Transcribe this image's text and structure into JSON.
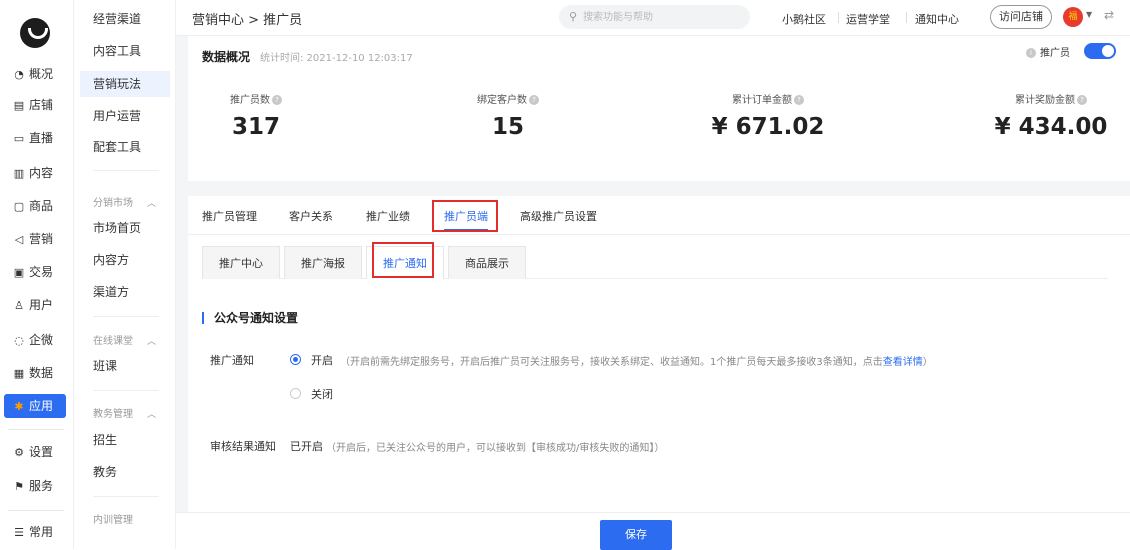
{
  "rail": {
    "items": [
      {
        "icon": "◔",
        "label": "概况"
      },
      {
        "icon": "▤",
        "label": "店铺"
      },
      {
        "icon": "▭",
        "label": "直播"
      },
      {
        "icon": "▥",
        "label": "内容"
      },
      {
        "icon": "▢",
        "label": "商品"
      },
      {
        "icon": "◁",
        "label": "营销"
      },
      {
        "icon": "▣",
        "label": "交易"
      },
      {
        "icon": "♙",
        "label": "用户"
      },
      {
        "icon": "◌",
        "label": "企微"
      },
      {
        "icon": "▦",
        "label": "数据"
      },
      {
        "icon": "✱",
        "label": "应用"
      },
      {
        "icon": "⚙",
        "label": "设置"
      },
      {
        "icon": "⚑",
        "label": "服务"
      },
      {
        "icon": "☰",
        "label": "常用"
      }
    ]
  },
  "submenu": {
    "items": [
      "经营渠道",
      "内容工具",
      "营销玩法",
      "用户运营",
      "配套工具",
      "市场首页",
      "内容方",
      "渠道方",
      "班课",
      "招生",
      "教务"
    ],
    "groups": [
      "分销市场",
      "在线课堂",
      "教务管理",
      "内训管理"
    ]
  },
  "topbar": {
    "breadcrumb": "营销中心 > 推广员",
    "search_placeholder": "搜索功能与帮助",
    "links": [
      "小鹅社区",
      "运营学堂",
      "通知中心"
    ],
    "visit_store": "访问店铺"
  },
  "overview": {
    "title": "数据概况",
    "time": "统计时间: 2021-12-10 12:03:17",
    "toggle_label": "推广员",
    "toggle_on": true,
    "stats": [
      {
        "label": "推广员数",
        "value": "317"
      },
      {
        "label": "绑定客户数",
        "value": "15"
      },
      {
        "label": "累计订单金额",
        "value": "¥ 671.02"
      },
      {
        "label": "累计奖励金额",
        "value": "¥ 434.00"
      }
    ]
  },
  "tabs": [
    "推广员管理",
    "客户关系",
    "推广业绩",
    "推广员端",
    "高级推广员设置"
  ],
  "active_tab": "推广员端",
  "subtabs": [
    "推广中心",
    "推广海报",
    "推广通知",
    "商品展示"
  ],
  "active_subtab": "推广通知",
  "section": {
    "title": "公众号通知设置",
    "promo_notice": {
      "label": "推广通知",
      "option_on": "开启",
      "option_on_desc": "（开启前需先绑定服务号，开启后推广员可关注服务号，接收关系绑定、收益通知。1个推广员每天最多接收3条通知，点击",
      "option_on_link": "查看详情",
      "option_on_desc_end": "）",
      "option_off": "关闭",
      "selected": "开启"
    },
    "audit_notice": {
      "label": "审核结果通知",
      "status": "已开启",
      "desc": "（开启后，已关注公众号的用户，可以接收到【审核成功/审核失败的通知】）"
    }
  },
  "footer": {
    "save_label": "保存"
  },
  "colors": {
    "primary": "#2b6cf0",
    "highlight": "#e02d2d"
  }
}
